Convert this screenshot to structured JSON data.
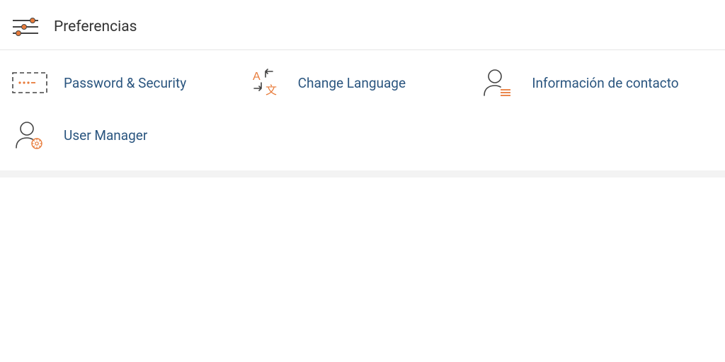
{
  "header": {
    "title": "Preferencias"
  },
  "items": [
    {
      "label": "Password & Security"
    },
    {
      "label": "Change Language"
    },
    {
      "label": "Información de contacto"
    },
    {
      "label": "User Manager"
    }
  ]
}
